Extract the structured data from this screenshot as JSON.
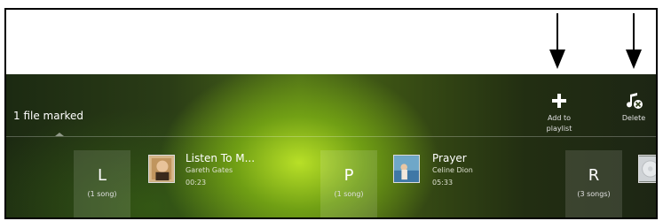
{
  "selection": {
    "status": "1 file marked"
  },
  "actions": {
    "add": {
      "icon": "plus-icon",
      "label_line1": "Add to",
      "label_line2": "playlist"
    },
    "delete": {
      "icon": "music-note-delete-icon",
      "label": "Delete"
    }
  },
  "groups": [
    {
      "letter": "L",
      "count": "(1 song)"
    },
    {
      "letter": "P",
      "count": "(1 song)"
    },
    {
      "letter": "R",
      "count": "(3 songs)"
    }
  ],
  "songs": [
    {
      "title": "Listen To M...",
      "artist": "Gareth Gates",
      "duration": "00:23",
      "art_icon": "album-art-portrait"
    },
    {
      "title": "Prayer",
      "artist": "Celine Dion",
      "duration": "05:33",
      "art_icon": "album-art-beach"
    }
  ],
  "colors": {
    "arrow": "#000000",
    "text": "#ffffff",
    "accent_green": "#9bcf22"
  }
}
